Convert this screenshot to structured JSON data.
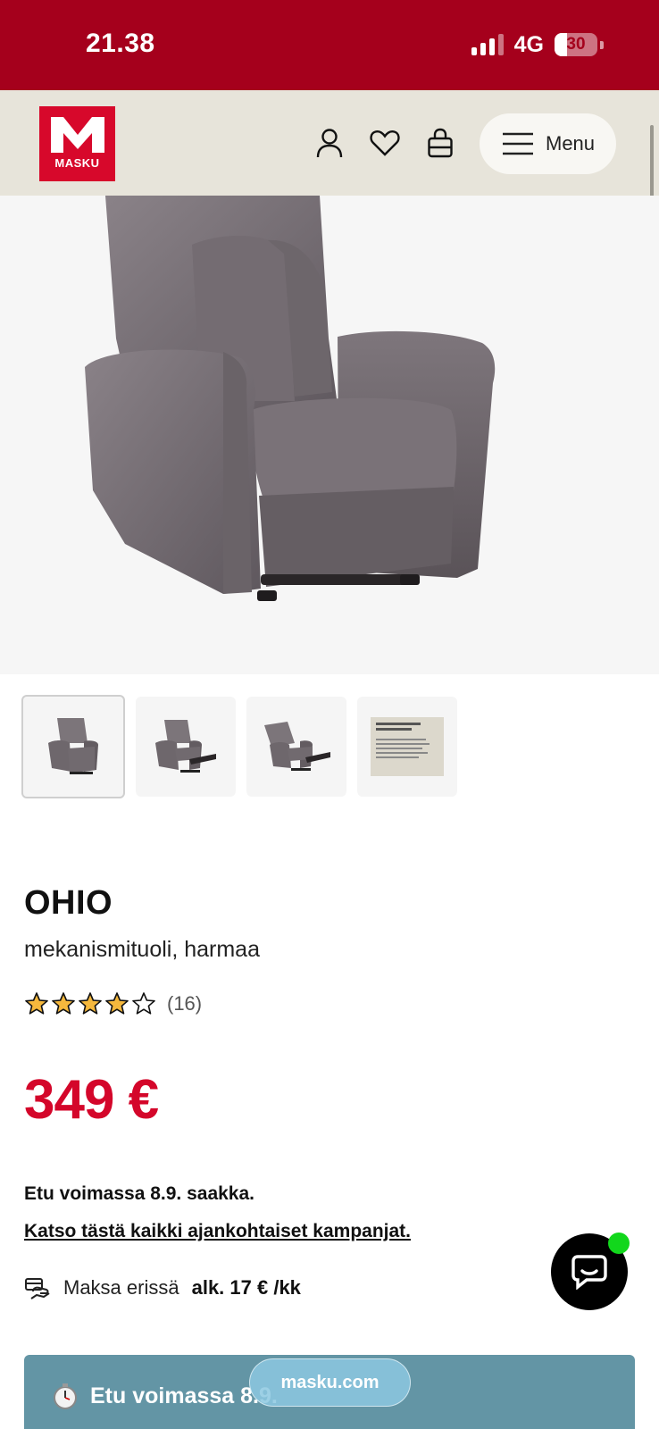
{
  "status_bar": {
    "time": "21.38",
    "network": "4G",
    "battery": "30",
    "battery_level": 0.3
  },
  "header": {
    "logo_text": "MASKU",
    "menu_label": "Menu",
    "icons": [
      "account-icon",
      "heart-icon",
      "shopping-bag-icon",
      "hamburger-icon"
    ]
  },
  "gallery": {
    "thumbnails": [
      "chair-front",
      "chair-reclined-1",
      "chair-reclined-2",
      "feature-card"
    ],
    "selected_index": 0
  },
  "product": {
    "name": "OHIO",
    "subtitle": "mekanismituoli, harmaa",
    "rating": 4,
    "rating_max": 5,
    "review_count": "(16)",
    "price": "349 €",
    "valid_text": "Etu voimassa 8.9. saakka.",
    "campaign_link": "Katso tästä kaikki ajankohtaiset kampanjat.",
    "installment_label": "Maksa erissä",
    "installment_value": "alk. 17 € /kk"
  },
  "promo_banner": {
    "text": "Etu voimassa 8.9."
  },
  "browser": {
    "url": "masku.com"
  },
  "colors": {
    "status_bar": "#a5001c",
    "header_bg": "#e7e4da",
    "brand_red": "#d7082b",
    "price_red": "#d4062a",
    "promo_bg": "#6395a5",
    "chat_online": "#12d71c"
  }
}
